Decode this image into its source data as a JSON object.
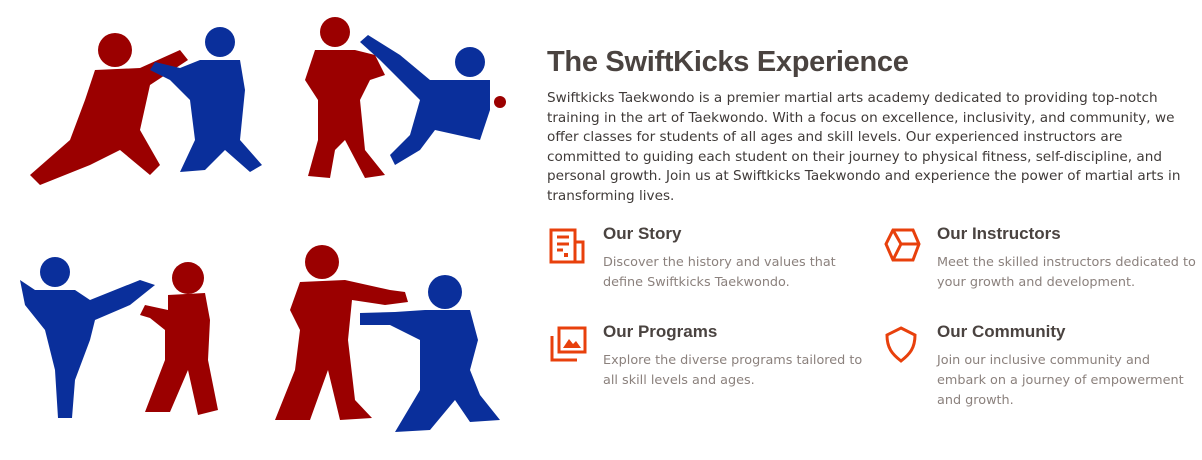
{
  "section": {
    "title": "The SwiftKicks Experience",
    "intro": "Swiftkicks Taekwondo is a premier martial arts academy dedicated to providing top-notch training in the art of Taekwondo. With a focus on excellence, inclusivity, and community, we offer classes for students of all ages and skill levels. Our experienced instructors are committed to guiding each student on their journey to physical fitness, self-discipline, and personal growth. Join us at Swiftkicks Taekwondo and experience the power of martial arts in transforming lives."
  },
  "features": [
    {
      "title": "Our Story",
      "description": "Discover the history and values that define Swiftkicks Taekwondo.",
      "icon": "newspaper-icon"
    },
    {
      "title": "Our Instructors",
      "description": "Meet the skilled instructors dedicated to your growth and development.",
      "icon": "cube-icon"
    },
    {
      "title": "Our Programs",
      "description": "Explore the diverse programs tailored to all skill levels and ages.",
      "icon": "gallery-icon"
    },
    {
      "title": "Our Community",
      "description": "Join our inclusive community and embark on a journey of empowerment and growth.",
      "icon": "shield-icon"
    }
  ],
  "colors": {
    "accent": "#e8400c",
    "red_figure": "#9b0000",
    "blue_figure": "#0a2f9b",
    "heading": "#4a4340",
    "muted": "#8b817d"
  }
}
